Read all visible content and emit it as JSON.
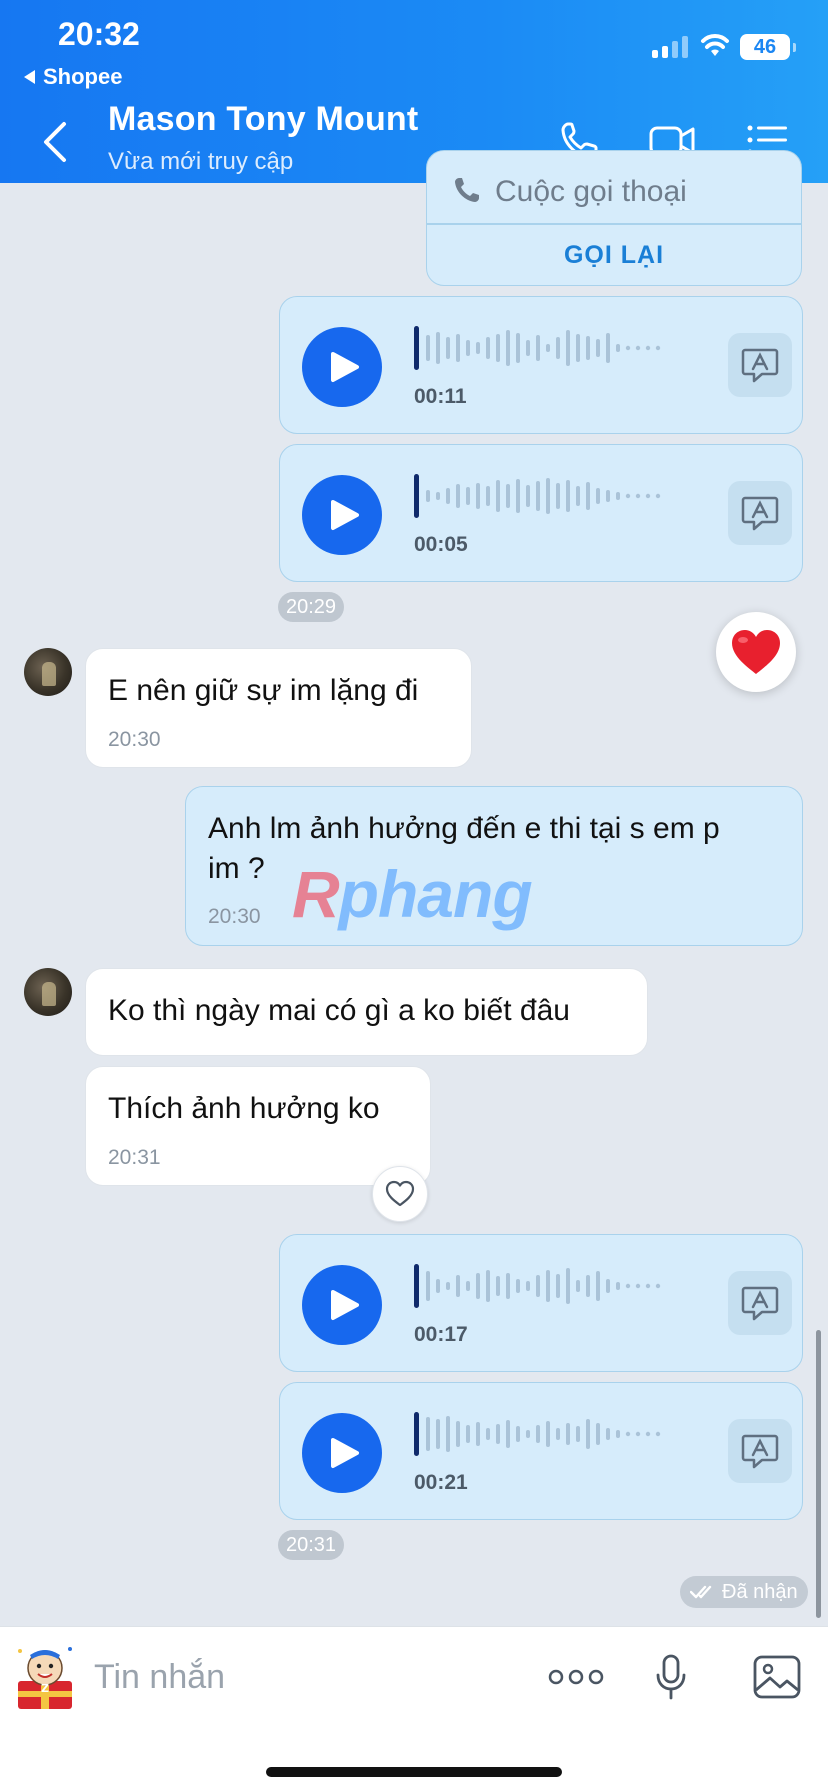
{
  "status_bar": {
    "time": "20:32",
    "back_app": "Shopee",
    "battery": "46"
  },
  "header": {
    "contact_name": "Mason Tony Mount",
    "contact_status": "Vừa mới truy cập"
  },
  "call_card": {
    "text": "Cuộc gọi thoại",
    "action": "GỌI LẠI"
  },
  "voice_messages": [
    {
      "duration": "00:11"
    },
    {
      "duration": "00:05"
    },
    {
      "duration": "00:17"
    },
    {
      "duration": "00:21"
    }
  ],
  "time_pills": [
    "20:29",
    "20:31"
  ],
  "messages": [
    {
      "text": "E nên giữ sự im lặng đi",
      "time": "20:30"
    },
    {
      "text_line1": "Anh lm ảnh hưởng đến e thi tại s em p",
      "text_line2": "im ?",
      "time": "20:30"
    },
    {
      "text": "Ko thì ngày mai có gì a ko biết đâu"
    },
    {
      "text": "Thích ảnh hưởng ko",
      "time": "20:31"
    }
  ],
  "watermark": {
    "prefix": "R",
    "rest": "phang"
  },
  "received_label": "Đã nhận",
  "composer": {
    "placeholder": "Tin nhắn"
  },
  "colors": {
    "header": "#1677f2",
    "accent": "#1768ee",
    "out_bubble": "#d6ecfb",
    "background": "#e3e8ef"
  }
}
